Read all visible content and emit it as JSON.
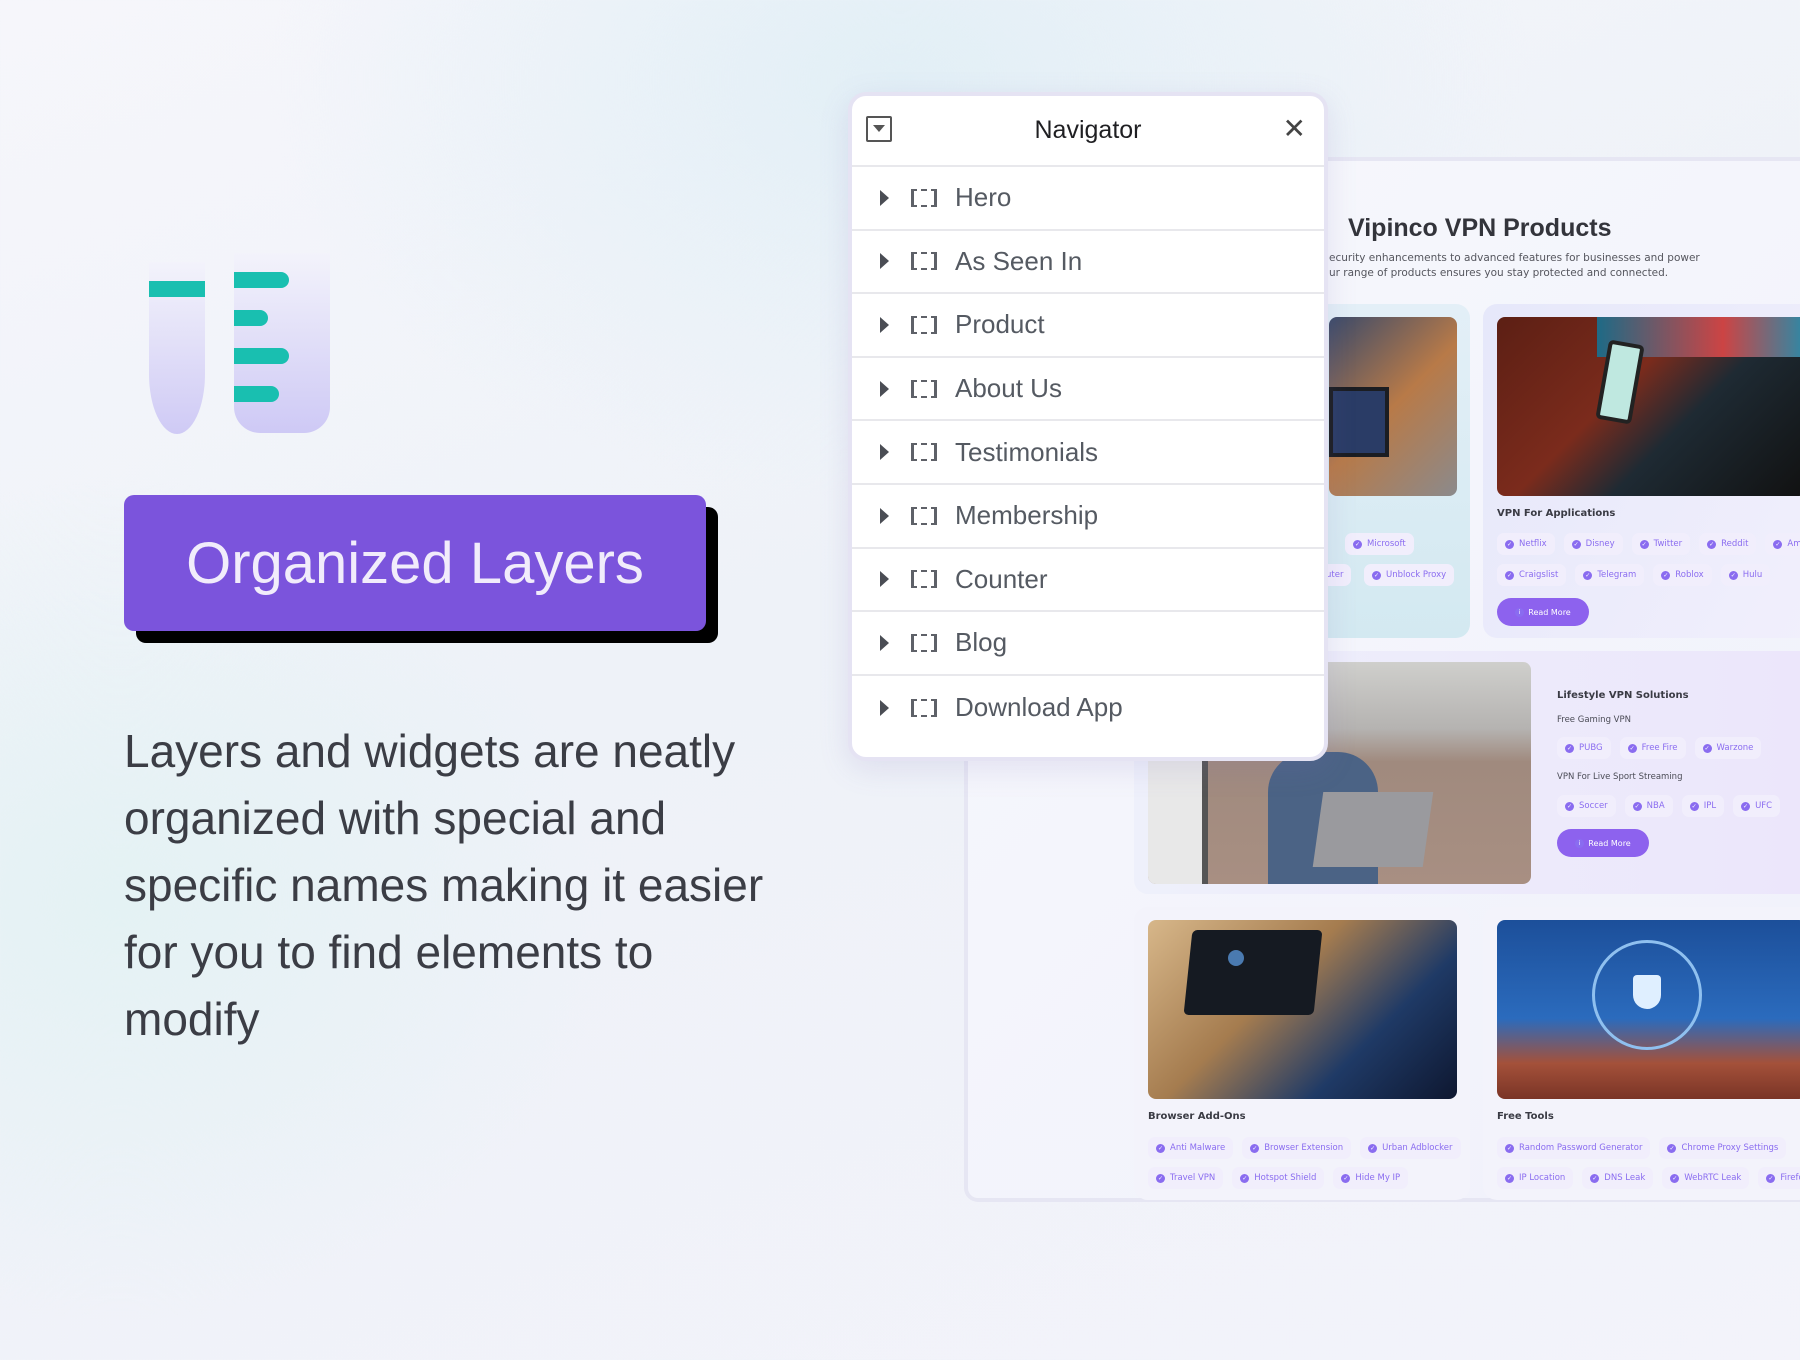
{
  "colors": {
    "accent": "#7b54dc",
    "teal": "#19bfb0",
    "tag_text": "#8a6cf0"
  },
  "hero": {
    "badge": "Organized Layers",
    "description": "Layers and widgets are neatly organized with special and specific names making it easier for you to find elements to modify"
  },
  "navigator": {
    "title": "Navigator",
    "toggle_icon": "dropdown-square-icon",
    "close_icon": "close-icon",
    "items": [
      "Hero",
      "As Seen In",
      "Product",
      "About Us",
      "Testimonials",
      "Membership",
      "Counter",
      "Blog",
      "Download App"
    ]
  },
  "mockup": {
    "title": "Vipinco VPN Products",
    "subtitle_1": "ecurity enhancements to advanced features for businesses and power",
    "subtitle_2": "ur range of products ensures you stay protected and connected.",
    "card1": {
      "tags_row1": [
        "Microsoft"
      ],
      "tags_row2_partial": "uter",
      "tags_row2": [
        "Unblock Proxy"
      ]
    },
    "card2": {
      "label": "VPN For Applications",
      "tags_row1": [
        "Netflix",
        "Disney",
        "Twitter",
        "Reddit",
        "Amazon"
      ],
      "tags_row2": [
        "Craigslist",
        "Telegram",
        "Roblox",
        "Hulu"
      ],
      "button": "Read More"
    },
    "card3": {
      "label": "Lifestyle VPN Solutions",
      "sub1": "Free Gaming VPN",
      "tags_row1": [
        "PUBG",
        "Free Fire",
        "Warzone"
      ],
      "sub2": "VPN For Live Sport Streaming",
      "tags_row2": [
        "Soccer",
        "NBA",
        "IPL",
        "UFC"
      ],
      "button": "Read More"
    },
    "card4": {
      "label": "Browser Add-Ons",
      "tags_row1": [
        "Anti Malware",
        "Browser Extension",
        "Urban Adblocker"
      ],
      "tags_row2": [
        "Travel VPN",
        "Hotspot Shield",
        "Hide My IP"
      ]
    },
    "card5": {
      "label": "Free Tools",
      "tags_row1": [
        "Random Password Generator",
        "Chrome Proxy Settings"
      ],
      "tags_row2": [
        "IP Location",
        "DNS Leak",
        "WebRTC Leak",
        "Firefox"
      ]
    }
  }
}
